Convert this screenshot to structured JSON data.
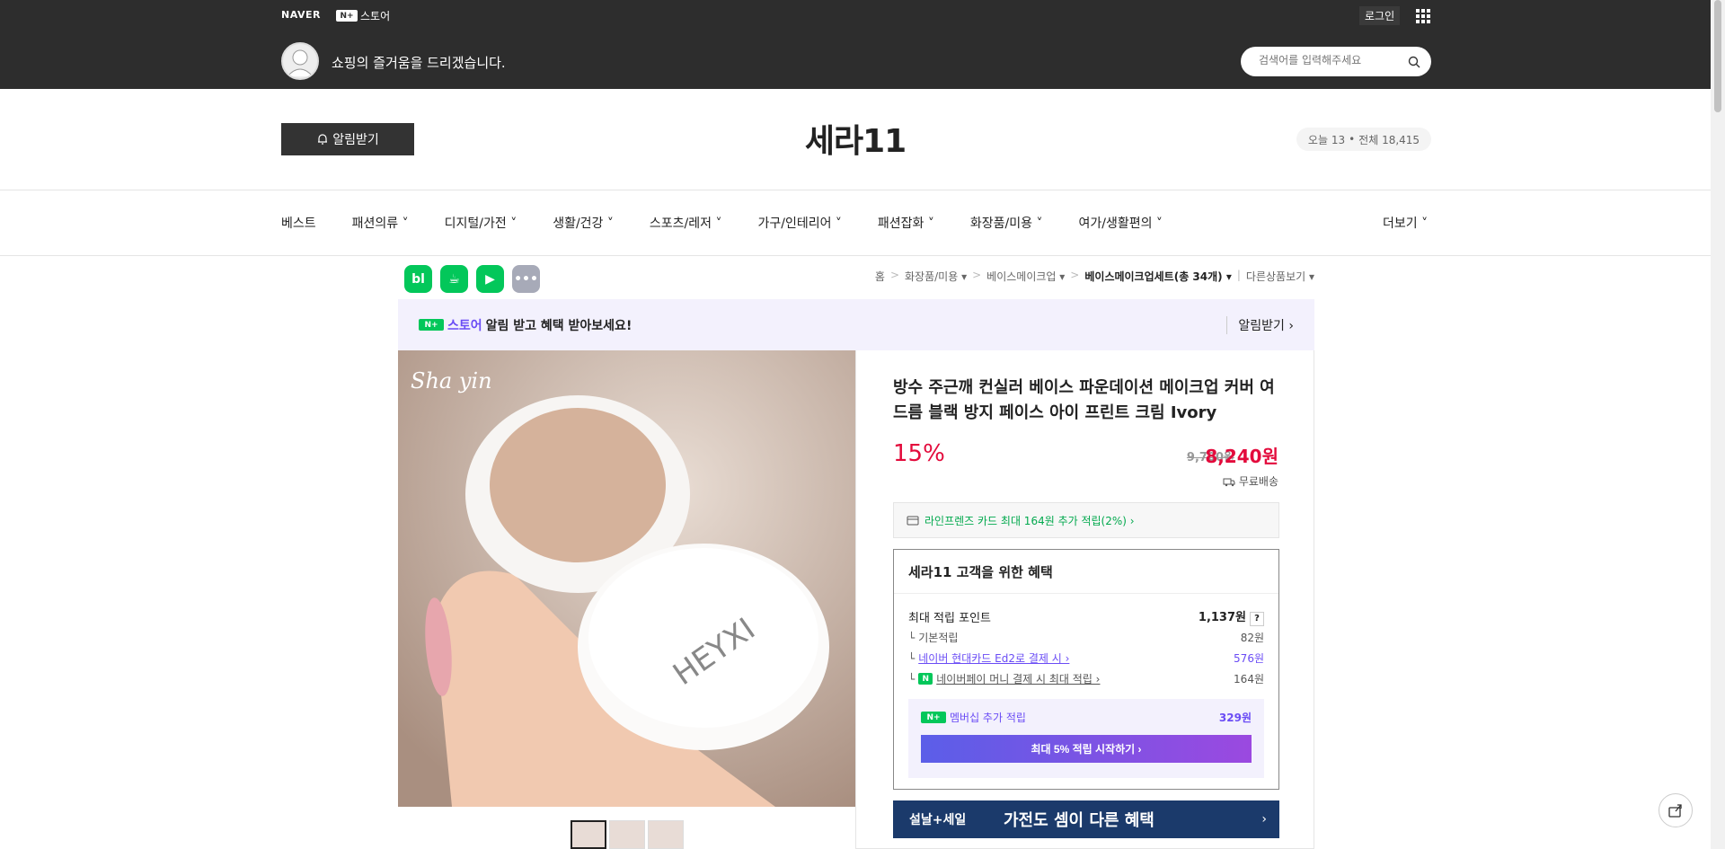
{
  "topbar": {
    "naver_logo": "NAVER",
    "nstore_badge": "N+",
    "nstore_label": "스토어",
    "login": "로그인",
    "slogan": "쇼핑의 즐거움을 드리겠습니다.",
    "search_placeholder": "검색어를 입력해주세요"
  },
  "header": {
    "alert_button": "알림받기",
    "store_name": "세라11",
    "visit_today": "오늘 13",
    "visit_total": "전체 18,415"
  },
  "nav": {
    "items": [
      "베스트",
      "패션의류 ˅",
      "디지털/가전 ˅",
      "생활/건강 ˅",
      "스포츠/레저 ˅",
      "가구/인테리어 ˅",
      "패션잡화 ˅",
      "화장품/미용 ˅",
      "여가/생활편의 ˅"
    ],
    "more": "더보기 ˅"
  },
  "sns": [
    {
      "label": "bl",
      "color": "#03c75a"
    },
    {
      "label": "☕",
      "color": "#03c75a"
    },
    {
      "label": "▶",
      "color": "#03c75a"
    },
    {
      "label": "•••",
      "color": "#a7aab8"
    }
  ],
  "breadcrumb": {
    "home": "홈",
    "c1": "화장품/미용 ▾",
    "c2": "베이스메이크업 ▾",
    "c3": "베이스메이크업세트(총 34개) ▾",
    "other": "다른상품보기 ▾"
  },
  "noti": {
    "badge": "N+",
    "store": "스토어",
    "text": "알림 받고 혜택 받아보세요!",
    "button": "알림받기 ›"
  },
  "product": {
    "title": "방수 주근깨 컨실러 베이스 파운데이션 메이크업 커버 여드름 블랙 방지 페이스 아이 프린트 크림 Ivory",
    "discount": "15%",
    "original_price": "9,700원",
    "price": "8,240원",
    "shipping": "무료배송",
    "card_promo": "라인프렌즈 카드 최대 164원 추가 적립(2%) ›",
    "image_brand": "HEYXI",
    "image_signature": "Sha yin"
  },
  "benefit": {
    "title": "세라11 고객을 위한 혜택",
    "max_points_label": "최대 적립 포인트",
    "max_points": "1,137원",
    "q": "?",
    "rows": [
      {
        "label": "기본적립",
        "value": "82원"
      },
      {
        "label": "네이버 현대카드 Ed2로 결제 시 ›",
        "value": "576원"
      },
      {
        "label": "네이버페이 머니 결제 시 최대 적립 ›",
        "value": "164원"
      }
    ],
    "member_badge": "N+",
    "member_label": "멤버십 추가 적립",
    "member_value": "329원",
    "member_button": "최대 5% 적립 시작하기 ›"
  },
  "banner": {
    "left": "설날+세일",
    "main": "가전도 셈이 다른 혜택",
    "chevron": "›"
  }
}
